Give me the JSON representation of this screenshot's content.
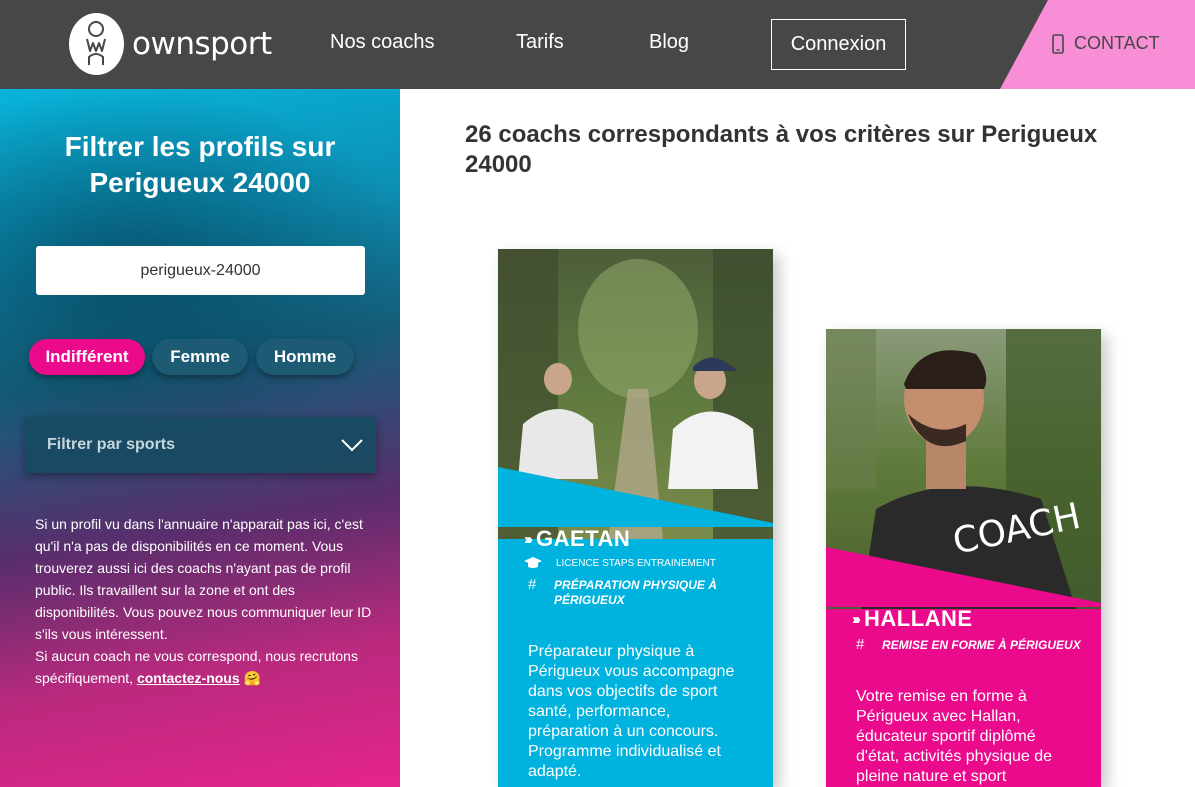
{
  "header": {
    "logo_text": "ownsport",
    "nav": {
      "coachs": "Nos coachs",
      "tarifs": "Tarifs",
      "blog": "Blog",
      "connexion": "Connexion",
      "contact": "CONTACT"
    }
  },
  "sidebar": {
    "title": "Filtrer les profils sur Perigueux 24000",
    "city_value": "perigueux-24000",
    "gender": {
      "indifferent": "Indifférent",
      "femme": "Femme",
      "homme": "Homme",
      "selected": "Indifférent"
    },
    "sport_filter_placeholder": "Filtrer par sports",
    "info_text": "Si un profil vu dans l'annuaire n'apparait pas ici, c'est qu'il n'a pas de disponibilités en ce moment. Vous trouverez aussi ici des coachs n'ayant pas de profil public. Ils travaillent sur la zone et ont des disponibilités. Vous pouvez nous communiquer leur ID s'ils vous intéressent.",
    "info_text2": "Si aucun coach ne vous correspond, nous recrutons spécifiquement, ",
    "contact_link": "contactez-nous",
    "emoji": "🤗"
  },
  "main": {
    "title": "26 coachs correspondants à vos critères sur Perigueux 24000"
  },
  "coaches": [
    {
      "name": "GAETAN",
      "diploma": "LICENCE STAPS ENTRAINEMENT",
      "specialty": "PRÉPARATION PHYSIQUE À PÉRIGUEUX",
      "description": "Préparateur physique à Périgueux vous accompagne dans vos objectifs de sport santé, performance, préparation à un concours. Programme individualisé et adapté.",
      "color": "#00b2de"
    },
    {
      "name": "HALLANE",
      "specialty": "REMISE EN FORME À PÉRIGUEUX",
      "description": "Votre remise en forme à Périgueux avec Hallan, éducateur sportif diplômé d'état, activités physique de pleine nature et sport",
      "shirt_text": "COACH",
      "color": "#ec0a8c"
    }
  ],
  "colors": {
    "header_bg": "#474747",
    "contact_bg": "#f78ed6",
    "accent_pink": "#ec0a8c",
    "accent_blue": "#00b2de"
  }
}
